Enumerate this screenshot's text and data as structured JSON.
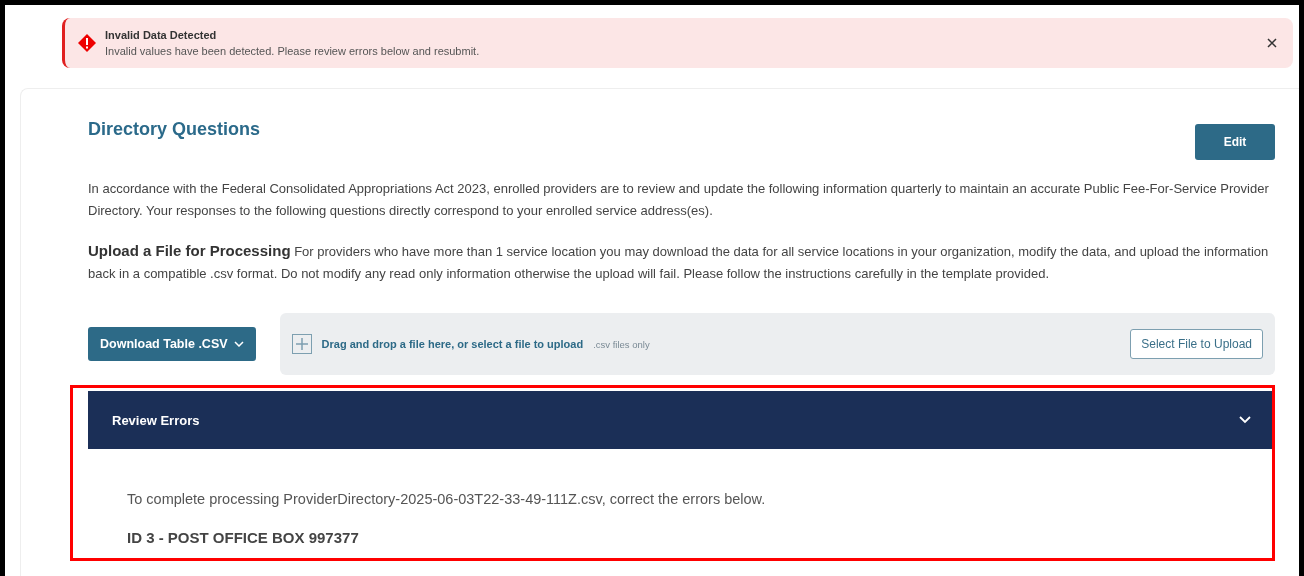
{
  "alert": {
    "title": "Invalid Data Detected",
    "message": "Invalid values have been detected. Please review errors below and resubmit."
  },
  "section": {
    "title": "Directory Questions",
    "edit_button": "Edit",
    "intro": "In accordance with the Federal Consolidated Appropriations Act 2023, enrolled providers are to review and update the following information quarterly to maintain an accurate Public Fee-For-Service Provider Directory. Your responses to the following questions directly correspond to your enrolled service address(es).",
    "upload_heading": "Upload a File for Processing",
    "upload_text": "For providers who have more than 1 service location you may download the data for all service locations in your organization, modify the data, and upload the information back in a compatible .csv format. Do not modify any read only information otherwise the upload will fail. Please follow the instructions carefully in the template provided."
  },
  "download_button": "Download Table .CSV",
  "dropzone": {
    "prompt": "Drag and drop a file here, or select a file to upload",
    "hint": ".csv files only",
    "button": "Select File to Upload"
  },
  "review_errors": {
    "title": "Review Errors",
    "expanded": true,
    "message": "To complete processing ProviderDirectory-2025-06-03T22-33-49-111Z.csv, correct the errors below.",
    "record": "ID 3 - POST OFFICE BOX 997377"
  }
}
